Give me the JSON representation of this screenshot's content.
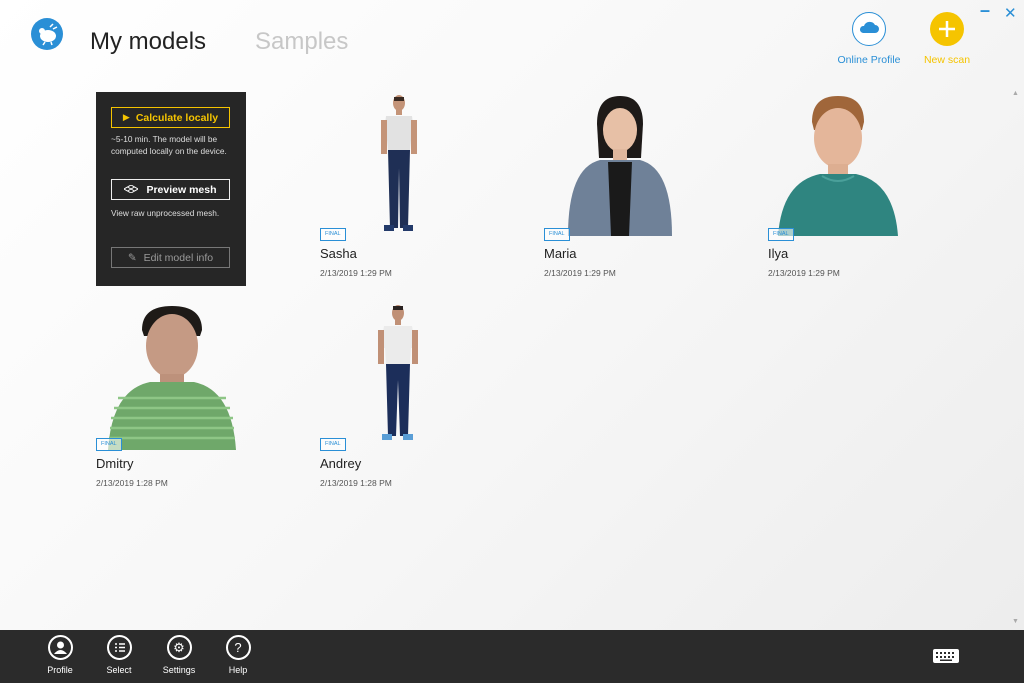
{
  "header": {
    "tabs": [
      {
        "label": "My models",
        "active": true
      },
      {
        "label": "Samples",
        "active": false
      }
    ],
    "actions": {
      "online_profile": "Online Profile",
      "new_scan": "New scan"
    },
    "colors": {
      "accent": "#2a8fd6",
      "scan": "#f5c400"
    }
  },
  "popup": {
    "calculate_label": "Calculate locally",
    "calculate_desc": "~5-10 min. The model will be computed locally on the device.",
    "preview_label": "Preview mesh",
    "preview_desc": "View raw unprocessed mesh.",
    "edit_label": "Edit model info"
  },
  "models": [
    {
      "name": "Sasha",
      "date": "2/13/2019 1:29 PM",
      "badge": "FINAL"
    },
    {
      "name": "Maria",
      "date": "2/13/2019 1:29 PM",
      "badge": "FINAL"
    },
    {
      "name": "Ilya",
      "date": "2/13/2019 1:29 PM",
      "badge": "FINAL"
    },
    {
      "name": "Dmitry",
      "date": "2/13/2019 1:28 PM",
      "badge": "FINAL"
    },
    {
      "name": "Andrey",
      "date": "2/13/2019 1:28 PM",
      "badge": "FINAL"
    }
  ],
  "taskbar": {
    "items": [
      {
        "label": "Profile",
        "icon": "person-icon"
      },
      {
        "label": "Select",
        "icon": "checklist-icon"
      },
      {
        "label": "Settings",
        "icon": "gear-icon"
      },
      {
        "label": "Help",
        "icon": "question-icon"
      }
    ],
    "keyboard_icon": "keyboard-icon"
  }
}
